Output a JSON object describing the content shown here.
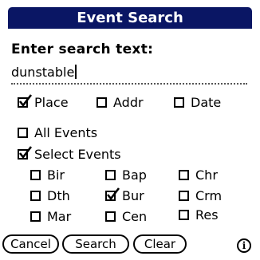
{
  "title": "Event Search",
  "prompt": "Enter search text:",
  "search_text": "dunstable",
  "fields": {
    "place": {
      "label": "Place",
      "checked": true
    },
    "addr": {
      "label": "Addr",
      "checked": false
    },
    "date": {
      "label": "Date",
      "checked": false
    }
  },
  "scope": {
    "all_events": {
      "label": "All Events",
      "checked": false
    },
    "select_events": {
      "label": "Select Events",
      "checked": true
    }
  },
  "events": [
    {
      "code": "bir",
      "label": "Bir",
      "checked": false
    },
    {
      "code": "bap",
      "label": "Bap",
      "checked": false
    },
    {
      "code": "chr",
      "label": "Chr",
      "checked": false
    },
    {
      "code": "dth",
      "label": "Dth",
      "checked": false
    },
    {
      "code": "bur",
      "label": "Bur",
      "checked": true
    },
    {
      "code": "crm",
      "label": "Crm",
      "checked": false
    },
    {
      "code": "mar",
      "label": "Mar",
      "checked": false
    },
    {
      "code": "cen",
      "label": "Cen",
      "checked": false
    },
    {
      "code": "res",
      "label": "Res",
      "checked": false
    }
  ],
  "buttons": {
    "cancel": "Cancel",
    "search": "Search",
    "clear": "Clear"
  },
  "info_glyph": "i",
  "colors": {
    "titlebar": "#0a1664"
  }
}
